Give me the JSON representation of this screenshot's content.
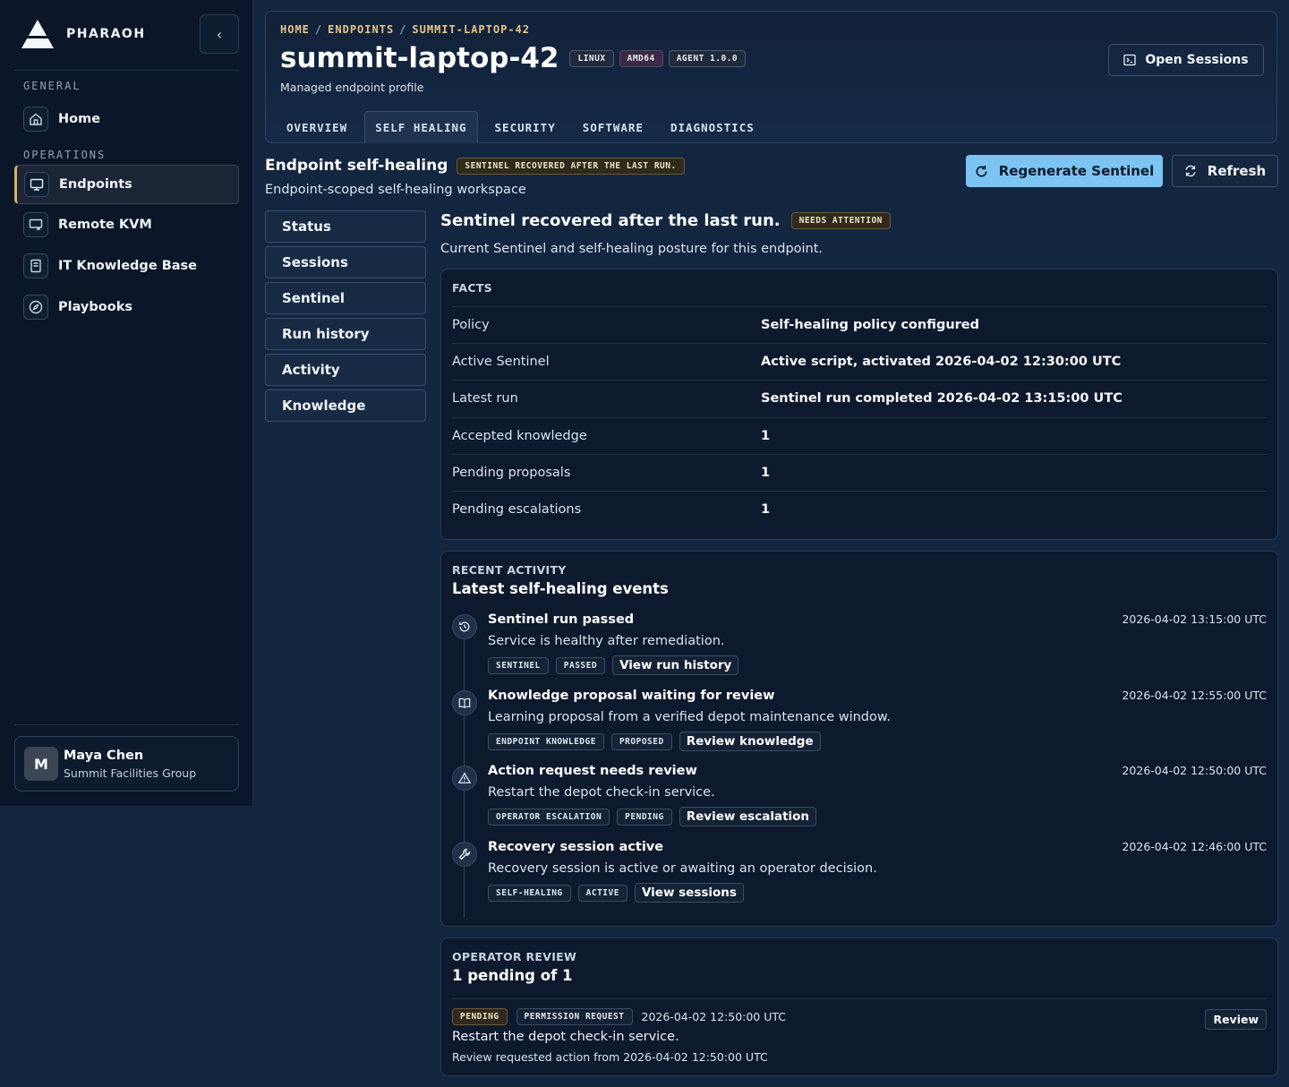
{
  "brand": {
    "name": "PHARAOH"
  },
  "sidebar": {
    "sections": [
      {
        "label": "GENERAL"
      },
      {
        "label": "OPERATIONS"
      }
    ],
    "items": [
      {
        "label": "Home",
        "icon": "home-icon"
      },
      {
        "label": "Endpoints",
        "icon": "monitor-icon",
        "active": true
      },
      {
        "label": "Remote KVM",
        "icon": "remote-screen-icon"
      },
      {
        "label": "IT Knowledge Base",
        "icon": "book-icon"
      },
      {
        "label": "Playbooks",
        "icon": "compass-icon"
      }
    ],
    "collapse_icon": "chevron-left-icon"
  },
  "user": {
    "initial": "M",
    "name": "Maya Chen",
    "org": "Summit Facilities Group"
  },
  "header": {
    "breadcrumb": [
      "HOME",
      "ENDPOINTS",
      "SUMMIT-LAPTOP-42"
    ],
    "title": "summit-laptop-42",
    "tags": [
      "LINUX",
      "AMD64",
      "AGENT 1.0.0"
    ],
    "subtitle": "Managed endpoint profile",
    "open_sessions_label": "Open Sessions",
    "tabs": [
      "OVERVIEW",
      "SELF HEALING",
      "SECURITY",
      "SOFTWARE",
      "DIAGNOSTICS"
    ],
    "active_tab": "SELF HEALING"
  },
  "section": {
    "title": "Endpoint self-healing",
    "badge": "SENTINEL RECOVERED AFTER THE LAST RUN.",
    "subtitle": "Endpoint-scoped self-healing workspace",
    "regenerate_label": "Regenerate Sentinel",
    "refresh_label": "Refresh"
  },
  "subnav": [
    "Status",
    "Sessions",
    "Sentinel",
    "Run history",
    "Activity",
    "Knowledge"
  ],
  "status": {
    "title": "Sentinel recovered after the last run.",
    "badge": "NEEDS ATTENTION",
    "subtitle": "Current Sentinel and self-healing posture for this endpoint."
  },
  "facts": {
    "label": "FACTS",
    "rows": [
      {
        "key": "Policy",
        "value": "Self-healing policy configured"
      },
      {
        "key": "Active Sentinel",
        "value": "Active script, activated 2026-04-02 12:30:00 UTC"
      },
      {
        "key": "Latest run",
        "value": "Sentinel run completed 2026-04-02 13:15:00 UTC"
      },
      {
        "key": "Accepted knowledge",
        "value": "1"
      },
      {
        "key": "Pending proposals",
        "value": "1"
      },
      {
        "key": "Pending escalations",
        "value": "1"
      }
    ]
  },
  "activity": {
    "label": "RECENT ACTIVITY",
    "title": "Latest self-healing events",
    "events": [
      {
        "icon": "history-icon",
        "title": "Sentinel run passed",
        "desc": "Service is healthy after remediation.",
        "time": "2026-04-02 13:15:00 UTC",
        "tags": [
          "SENTINEL",
          "PASSED"
        ],
        "link": "View run history"
      },
      {
        "icon": "book-open-icon",
        "title": "Knowledge proposal waiting for review",
        "desc": "Learning proposal from a verified depot maintenance window.",
        "time": "2026-04-02 12:55:00 UTC",
        "tags": [
          "ENDPOINT KNOWLEDGE",
          "PROPOSED"
        ],
        "link": "Review knowledge"
      },
      {
        "icon": "warning-icon",
        "title": "Action request needs review",
        "desc": "Restart the depot check-in service.",
        "time": "2026-04-02 12:50:00 UTC",
        "tags": [
          "OPERATOR ESCALATION",
          "PENDING"
        ],
        "link": "Review escalation"
      },
      {
        "icon": "wrench-icon",
        "title": "Recovery session active",
        "desc": "Recovery session is active or awaiting an operator decision.",
        "time": "2026-04-02 12:46:00 UTC",
        "tags": [
          "SELF-HEALING",
          "ACTIVE"
        ],
        "link": "View sessions"
      }
    ]
  },
  "review": {
    "label": "OPERATOR REVIEW",
    "title": "1 pending of 1",
    "item": {
      "tags": [
        "PENDING",
        "PERMISSION REQUEST"
      ],
      "time": "2026-04-02 12:50:00 UTC",
      "title": "Restart the depot check-in service.",
      "desc": "Review requested action from 2026-04-02 12:50:00 UTC",
      "action": "Review"
    }
  },
  "colors": {
    "accent": "#7cc4f2",
    "active_marker": "#d9b25f",
    "breadcrumb": "#e8c486",
    "background": "#132640"
  }
}
